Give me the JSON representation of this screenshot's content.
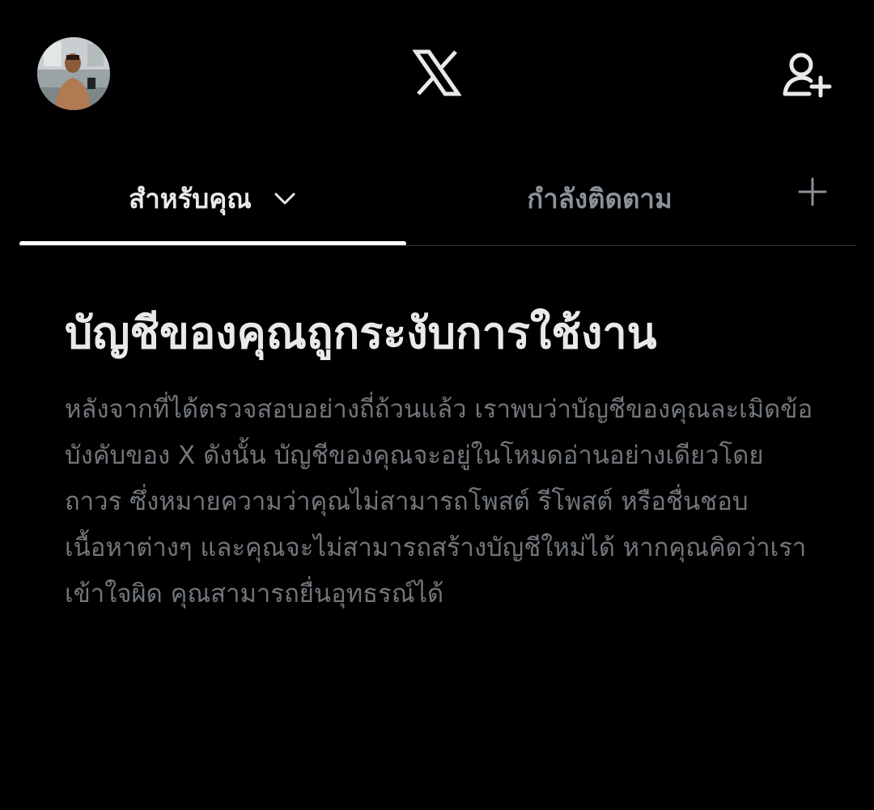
{
  "header": {
    "logo_icon": "x-logo-icon",
    "avatar_icon": "user-avatar",
    "follow_icon": "add-user-icon"
  },
  "tabs": {
    "items": [
      {
        "label": "สำหรับคุณ",
        "active": true
      },
      {
        "label": "กำลังติดตาม",
        "active": false
      }
    ],
    "add_icon": "plus-icon",
    "dropdown_icon": "chevron-down-icon"
  },
  "notice": {
    "title": "บัญชีของคุณถูกระงับการใช้งาน",
    "body": "หลังจากที่ได้ตรวจสอบอย่างถี่ถ้วนแล้ว เราพบว่าบัญชีของคุณละเมิดข้อบังคับของ X ดังนั้น บัญชีของคุณจะอยู่ในโหมดอ่านอย่างเดียวโดยถาวร ซึ่งหมายความว่าคุณไม่สามารถโพสต์ รีโพสต์ หรือชื่นชอบเนื้อหาต่างๆ และคุณจะไม่สามารถสร้างบัญชีใหม่ได้ หากคุณคิดว่าเราเข้าใจผิด คุณสามารถยื่นอุทธรณ์ได้"
  },
  "colors": {
    "background": "#000000",
    "text_primary": "#e7e9ea",
    "text_secondary": "#71767b",
    "tab_inactive": "#8b9298",
    "divider": "#2f3336",
    "indicator": "#ffffff"
  }
}
